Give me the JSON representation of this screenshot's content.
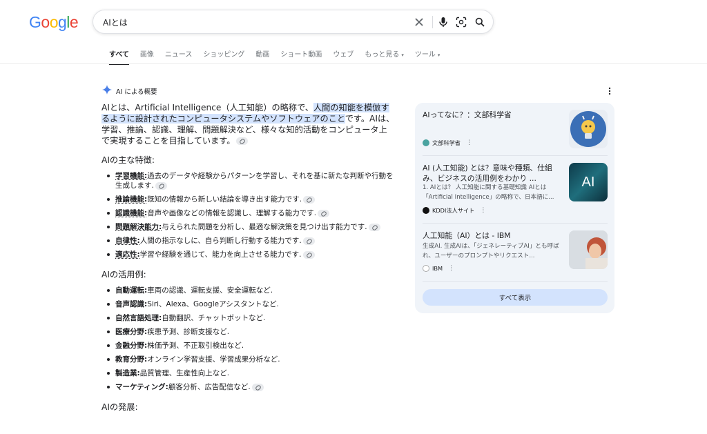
{
  "logo": {
    "text": "Google",
    "letters": [
      {
        "ch": "G",
        "color": "#4285F4"
      },
      {
        "ch": "o",
        "color": "#EA4335"
      },
      {
        "ch": "o",
        "color": "#FBBC05"
      },
      {
        "ch": "g",
        "color": "#4285F4"
      },
      {
        "ch": "l",
        "color": "#34A853"
      },
      {
        "ch": "e",
        "color": "#EA4335"
      }
    ]
  },
  "search": {
    "query": "AIとは"
  },
  "tabs": [
    {
      "label": "すべて",
      "active": true
    },
    {
      "label": "画像"
    },
    {
      "label": "ニュース"
    },
    {
      "label": "ショッピング"
    },
    {
      "label": "動画"
    },
    {
      "label": "ショート動画"
    },
    {
      "label": "ウェブ"
    },
    {
      "label": "もっと見る",
      "caret": "▾"
    },
    {
      "label": "ツール",
      "caret": "▾"
    }
  ],
  "ai_overview": {
    "label": "AI による概要",
    "intro_before": "AIとは、Artificial Intelligence（人工知能）の略称で、",
    "intro_highlight": "人間の知能を模倣するように設計されたコンピュータシステムやソフトウェアのこと",
    "intro_after": "です。AIは、学習、推論、認識、理解、問題解決など、様々な知的活動をコンピュータ上で実現することを目指しています。",
    "features_title": "AIの主な特徴:",
    "features": [
      {
        "term": "学習機能:",
        "desc": "過去のデータや経験からパターンを学習し、それを基に新たな判断や行動を生成します."
      },
      {
        "term": "推論機能:",
        "desc": "既知の情報から新しい結論を導き出す能力です."
      },
      {
        "term": "認識機能:",
        "desc": "音声や画像などの情報を認識し、理解する能力です."
      },
      {
        "term": "問題解決能力:",
        "desc": "与えられた問題を分析し、最適な解決策を見つけ出す能力です."
      },
      {
        "term": "自律性:",
        "desc": "人間の指示なしに、自ら判断し行動する能力です."
      },
      {
        "term": "適応性:",
        "desc": "学習や経験を通じて、能力を向上させる能力です."
      }
    ],
    "uses_title": "AIの活用例:",
    "uses": [
      {
        "term": "自動運転:",
        "desc": "車両の認識、運転支援、安全運転など."
      },
      {
        "term": "音声認識:",
        "desc": "Siri、Alexa、Googleアシスタントなど."
      },
      {
        "term": "自然言語処理:",
        "desc": "自動翻訳、チャットボットなど."
      },
      {
        "term": "医療分野:",
        "desc": "疾患予測、診断支援など."
      },
      {
        "term": "金融分野:",
        "desc": "株価予測、不正取引検出など."
      },
      {
        "term": "教育分野:",
        "desc": "オンライン学習支援、学習成果分析など."
      },
      {
        "term": "製造業:",
        "desc": "品質管理、生産性向上など."
      },
      {
        "term": "マーケティング:",
        "desc": "顧客分析、広告配信など."
      }
    ],
    "development_title": "AIの発展:"
  },
  "sources": {
    "cards": [
      {
        "title": "AIってなに？：文部科学省",
        "snippet": "",
        "source": "文部科学省",
        "favicon_color": "#4aa3a0"
      },
      {
        "title": "AI (人工知能) とは？意味や種類、仕組み、ビジネスの活用例をわかり ...",
        "snippet": "1.  AIとは？ 人工知能に関する基礎知識 AIとは「Artificial Intelligence」の略称で、日本語に...",
        "source": "KDDI法人サイト",
        "favicon_color": "#111111"
      },
      {
        "title": "人工知能（AI）とは - IBM",
        "snippet": "生成AI. 生成AIは、「ジェネレーティブAI」とも呼ばれ、ユーザーのプロンプトやリクエスト...",
        "source": "IBM",
        "favicon_color": "#ffffff"
      }
    ],
    "thumb_ai_text": "AI",
    "show_all": "すべて表示"
  }
}
